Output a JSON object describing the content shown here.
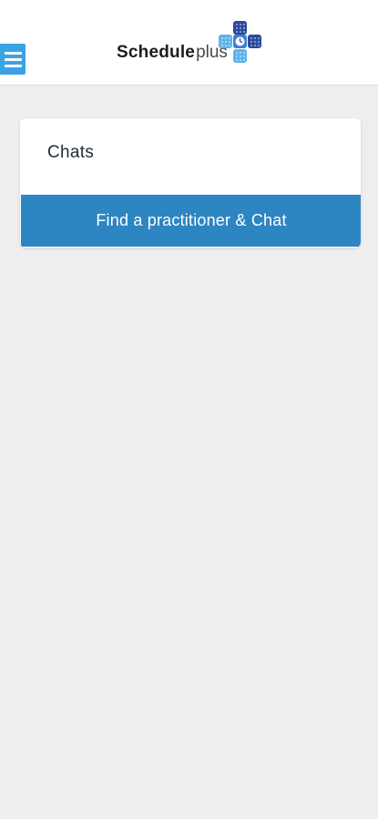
{
  "header": {
    "logo": {
      "text_bold": "Schedule",
      "text_light": "plus"
    },
    "menu_icon": "hamburger-menu-icon",
    "colors": {
      "menu_button": "#3aa3e6",
      "logo_cross_dark": "#2c4a9a",
      "logo_cross_light": "#5fb4e6"
    }
  },
  "chats_card": {
    "title": "Chats",
    "button_label": "Find a practitioner & Chat"
  },
  "colors": {
    "background": "#eeeeee",
    "primary": "#2d85c2",
    "card": "#ffffff"
  }
}
